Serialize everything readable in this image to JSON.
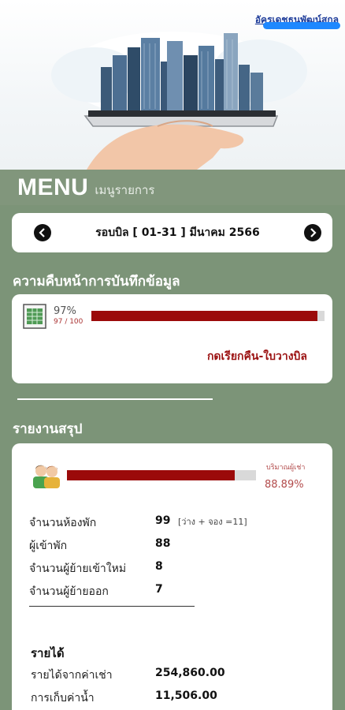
{
  "header": {
    "owner_name": "อัครเดชธนพัฒน์สกุล"
  },
  "menu": {
    "title": "MENU",
    "subtitle": "เมนูรายการ"
  },
  "billing": {
    "round_label": "รอบบิล [ 01-31 ] มีนาคม 2566"
  },
  "progress": {
    "section_title": "ความคืบหน้าการบันทึกข้อมูล",
    "percent_text": "97%",
    "count_text": "97 / 100",
    "fill_fraction": 0.97,
    "recall_link": "กดเรียกคืน-ใบวางบิล"
  },
  "summary": {
    "section_title": "รายงานสรุป",
    "occupancy_label": "บริมาณผู้เช่า",
    "occupancy_value": "88.89%",
    "occupancy_fraction": 0.8889,
    "stats": [
      {
        "label": "จำนวนห้องพัก",
        "value": "99",
        "note": "[ว่าง + จอง =11]"
      },
      {
        "label": "ผู้เข้าพัก",
        "value": "88",
        "note": ""
      },
      {
        "label": "จำนวนผู้ย้ายเข้าใหม่",
        "value": "8",
        "note": ""
      },
      {
        "label": "จำนวนผู้ย้ายออก",
        "value": "7",
        "note": ""
      }
    ],
    "income_heading": "รายได้",
    "income": [
      {
        "label": "รายได้จากค่าเช่า",
        "value": "254,860.00"
      },
      {
        "label": "การเก็บค่าน้ำ",
        "value": "11,506.00"
      }
    ]
  },
  "colors": {
    "background": "#7c9478",
    "bar_fill": "#9b0a0a",
    "link": "#9b1111",
    "owner_scribble": "#1e88ff"
  },
  "icons": [
    "city-phone-illustration",
    "chevron-left-icon",
    "chevron-right-icon",
    "ledger-icon",
    "people-icon"
  ]
}
